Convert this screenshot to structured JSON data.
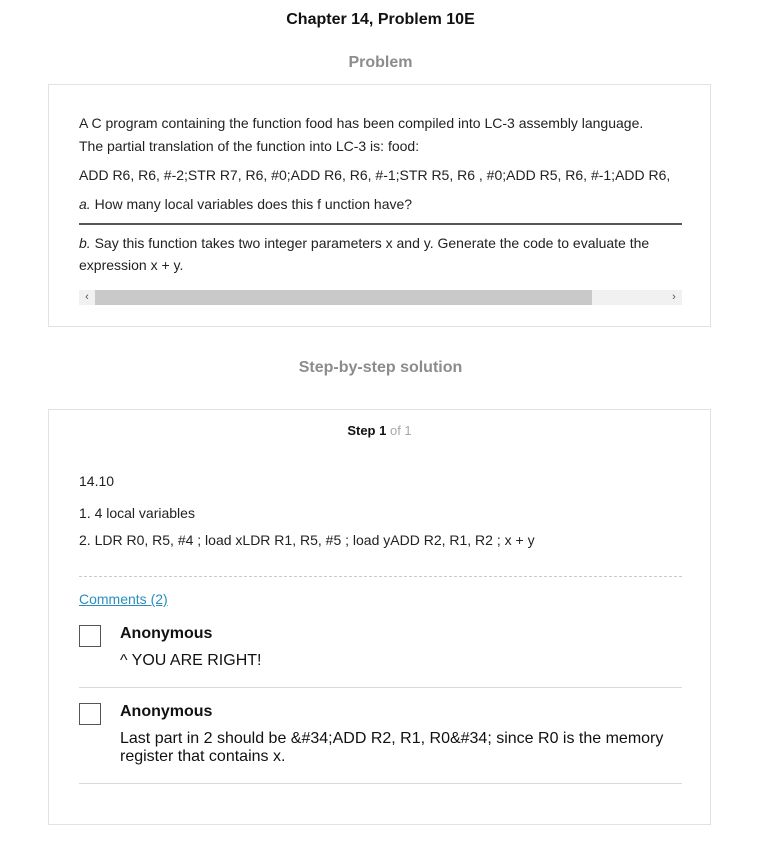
{
  "header": {
    "chapter_title": "Chapter 14, Problem 10E"
  },
  "problem": {
    "heading": "Problem",
    "intro_line1": "A C program containing the function food has been compiled into LC-3 assembly language.",
    "intro_line2": "The partial translation of the function into LC-3 is: food:",
    "code_line": "ADD R6, R6, #-2;STR R7, R6, #0;ADD R6, R6, #-1;STR R5, R6 , #0;ADD R5, R6, #-1;ADD R6,",
    "part_a_label": "a.",
    "part_a_text": " How many local variables does this f unction have?",
    "part_b_label": "b.",
    "part_b_text": " Say this function takes two integer parameters x and y. Generate the code to evaluate the expression x + y.",
    "scroll_left_glyph": "‹",
    "scroll_right_glyph": "›"
  },
  "solution": {
    "heading": "Step-by-step solution",
    "step_label": "Step 1",
    "step_of": "of 1",
    "ref": "14.10",
    "answer_1": "1. 4 local variables",
    "answer_2": "2. LDR R0, R5, #4 ; load xLDR R1, R5, #5 ; load yADD R2, R1, R2 ; x + y",
    "comments_link": "Comments (2)",
    "comments": [
      {
        "author": "Anonymous",
        "text": "^ YOU ARE RIGHT!"
      },
      {
        "author": "Anonymous",
        "text": "Last part in 2 should be &#34;ADD R2, R1, R0&#34; since R0 is the memory register that contains x."
      }
    ]
  },
  "colors": {
    "link": "#2a8fbd",
    "heading_gray": "#8c8c8c",
    "card_border": "#e2e2e2"
  }
}
